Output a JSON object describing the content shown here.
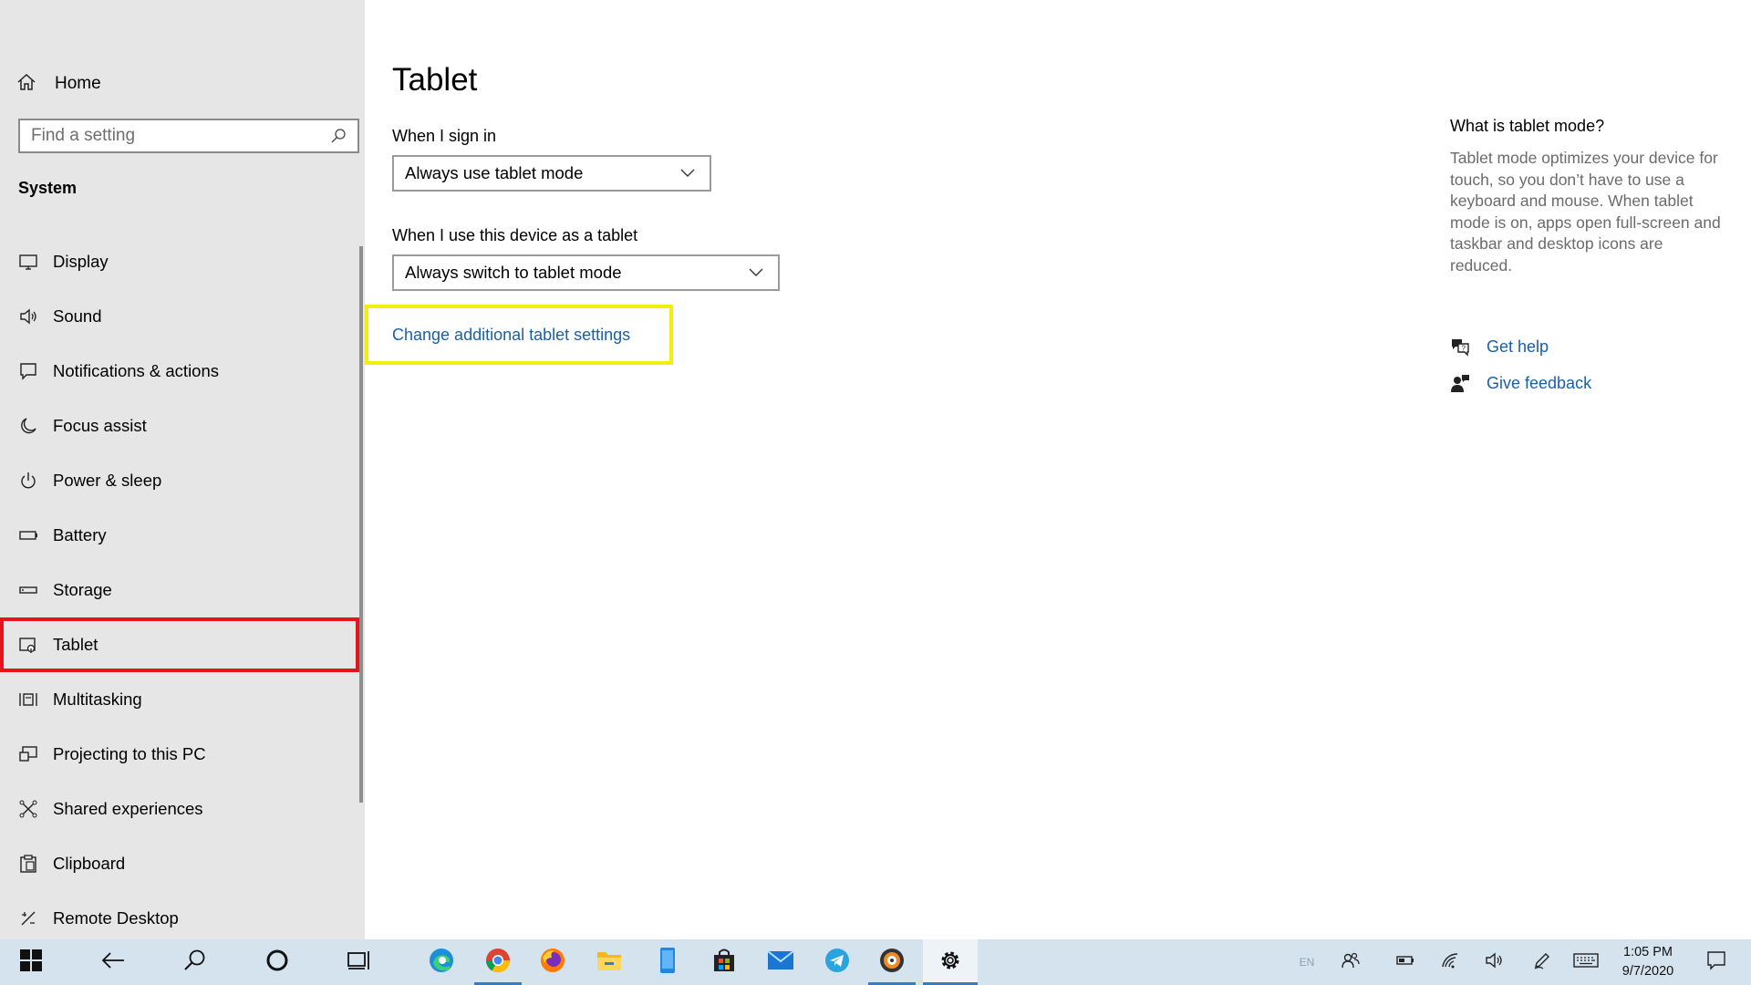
{
  "sidebar": {
    "home_label": "Home",
    "search_placeholder": "Find a setting",
    "section_title": "System",
    "items": [
      {
        "label": "Display",
        "icon": "monitor-icon"
      },
      {
        "label": "Sound",
        "icon": "speaker-icon"
      },
      {
        "label": "Notifications & actions",
        "icon": "notification-icon"
      },
      {
        "label": "Focus assist",
        "icon": "moon-icon"
      },
      {
        "label": "Power & sleep",
        "icon": "power-icon"
      },
      {
        "label": "Battery",
        "icon": "battery-icon"
      },
      {
        "label": "Storage",
        "icon": "storage-icon"
      },
      {
        "label": "Tablet",
        "icon": "tablet-icon",
        "selected": true
      },
      {
        "label": "Multitasking",
        "icon": "multitasking-icon"
      },
      {
        "label": "Projecting to this PC",
        "icon": "projecting-icon"
      },
      {
        "label": "Shared experiences",
        "icon": "shared-icon"
      },
      {
        "label": "Clipboard",
        "icon": "clipboard-icon"
      },
      {
        "label": "Remote Desktop",
        "icon": "remote-desktop-icon"
      }
    ]
  },
  "main": {
    "title": "Tablet",
    "sign_in_label": "When I sign in",
    "sign_in_value": "Always use tablet mode",
    "tablet_use_label": "When I use this device as a tablet",
    "tablet_use_value": "Always switch to tablet mode",
    "additional_link": "Change additional tablet settings"
  },
  "aside": {
    "title": "What is tablet mode?",
    "description": "Tablet mode optimizes your device for touch, so you don’t have to use a keyboard and mouse. When tablet mode is on, apps open full-screen and taskbar and desktop icons are reduced.",
    "get_help": "Get help",
    "give_feedback": "Give feedback"
  },
  "taskbar": {
    "language": "EN",
    "time": "1:05 PM",
    "date": "9/7/2020",
    "apps": [
      "edge-icon",
      "chrome-icon",
      "firefox-icon",
      "file-explorer-icon",
      "phone-icon",
      "store-icon",
      "mail-icon",
      "telegram-icon",
      "media-player-icon",
      "settings-icon"
    ]
  },
  "colors": {
    "sidebar_bg": "#e6e6e6",
    "link": "#1a5fa8",
    "selection_outline": "#e3141e",
    "highlight_outline": "#f4ee10",
    "taskbar_bg": "#d5e3ef"
  }
}
